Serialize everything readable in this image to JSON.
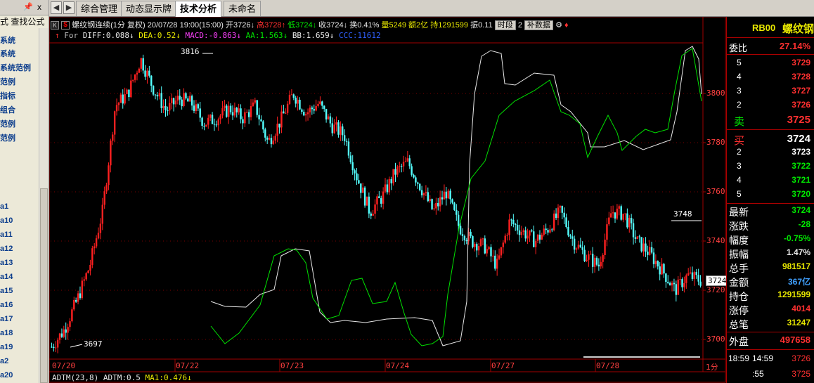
{
  "left_panel": {
    "pin_icon": "pin-icon",
    "close_label": "x",
    "header_text": "式  查找公式",
    "items": [
      "系统",
      "系统",
      "系统范例",
      "范例",
      "指标",
      "组合",
      "范例",
      "范例",
      "a1",
      "a10",
      "a11",
      "a12",
      "a13",
      "a14",
      "a15",
      "a16",
      "a17",
      "a18",
      "a19",
      "a2",
      "a20"
    ]
  },
  "tabs": {
    "items": [
      "综合管理",
      "动态显示牌",
      "技术分析",
      "未命名"
    ],
    "active": "技术分析"
  },
  "chart_header": {
    "k_label": "K",
    "dollar": "$",
    "name": "螺纹钢连续(1分",
    "restore": "复权)",
    "datetime": "20/07/28 19:00(15:00)",
    "open": "开3726",
    "high": "高3728",
    "low": "低3724",
    "close": "收3724",
    "turnover": "换0.41%",
    "volume": "量5249",
    "amount": "额2亿",
    "position": "持1291599",
    "amplitude": "振0.11",
    "btn_period": "时段",
    "btn_supplement": "补数据",
    "more_mark": "2"
  },
  "indicator_line": {
    "prefix": "For",
    "diff": "DIFF:0.088",
    "dea": "DEA:0.52",
    "macd": "MACD:-0.863",
    "aa": "AA:1.563",
    "bb": "BB:1.659",
    "ccc": "CCC:11612",
    "colors": {
      "diff": "#e8e8e8",
      "dea": "#e8e800",
      "macd": "#ff40ff",
      "aa": "#00e800",
      "bb": "#e8e8e8",
      "ccc": "#3060ff"
    }
  },
  "price_annotations": {
    "high_mark": "3816",
    "low_mark": "3697",
    "ref_line": "3748",
    "current": "3724"
  },
  "bottom_indicator": {
    "adtm": "ADTM(23,8)",
    "adtm_val": "ADTM:0.5",
    "ma1": "MA1:0.476"
  },
  "period_label": "1分",
  "chart_data": {
    "type": "line",
    "title": "螺纹钢连续(1分",
    "x_tick_labels": [
      "07/20",
      "07/22",
      "07/23",
      "07/24",
      "07/27",
      "07/28"
    ],
    "y_tick_labels": [
      3700,
      3720,
      3740,
      3760,
      3780,
      3800
    ],
    "ylim": [
      3694,
      3824
    ],
    "price_close_approx": [
      3697,
      3704,
      3716,
      3730,
      3752,
      3795,
      3800,
      3814,
      3802,
      3793,
      3798,
      3796,
      3788,
      3790,
      3794,
      3790,
      3795,
      3780,
      3789,
      3800,
      3792,
      3796,
      3787,
      3783,
      3766,
      3752,
      3758,
      3768,
      3772,
      3762,
      3752,
      3760,
      3746,
      3740,
      3738,
      3730,
      3748,
      3744,
      3740,
      3745,
      3752,
      3740,
      3734,
      3730,
      3752,
      3751,
      3740,
      3735,
      3728,
      3720,
      3726,
      3724
    ],
    "series": [
      {
        "name": "AA",
        "color": "#00e800"
      },
      {
        "name": "BB",
        "color": "#e8e8e8"
      }
    ]
  },
  "quote_panel": {
    "code": "RB00",
    "name": "螺纹钢",
    "weibi_label": "委比",
    "weibi_value": "27.14%",
    "asks": [
      {
        "level": "5",
        "price": "3729"
      },
      {
        "level": "4",
        "price": "3728"
      },
      {
        "level": "3",
        "price": "3727"
      },
      {
        "level": "2",
        "price": "3726"
      },
      {
        "level": "卖",
        "price": "3725"
      }
    ],
    "bids": [
      {
        "level": "买",
        "price": "3724"
      },
      {
        "level": "2",
        "price": "3723"
      },
      {
        "level": "3",
        "price": "3722"
      },
      {
        "level": "4",
        "price": "3721"
      },
      {
        "level": "5",
        "price": "3720"
      }
    ],
    "stats": [
      {
        "label": "最新",
        "value": "3724",
        "color": "#00e800"
      },
      {
        "label": "涨跌",
        "value": "-28",
        "color": "#00e800"
      },
      {
        "label": "幅度",
        "value": "-0.75%",
        "color": "#00e800"
      },
      {
        "label": "振幅",
        "value": "1.47%",
        "color": "#e8e8e8"
      },
      {
        "label": "总手",
        "value": "981517",
        "color": "#e8e800"
      },
      {
        "label": "金额",
        "value": "367亿",
        "color": "#40a0ff"
      },
      {
        "label": "持仓",
        "value": "1291599",
        "color": "#e8e800"
      },
      {
        "label": "涨停",
        "value": "4014",
        "color": "#ff3030"
      },
      {
        "label": "总笔",
        "value": "31247",
        "color": "#e8e800"
      }
    ],
    "outer_label": "外盘",
    "outer_value": "497658",
    "ticks": [
      {
        "time": "18:59",
        "sec": "14:59",
        "price": "3726"
      },
      {
        "time": "",
        "sec": ":55",
        "price": "3725"
      }
    ]
  }
}
